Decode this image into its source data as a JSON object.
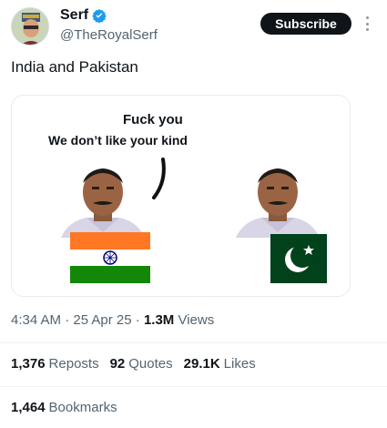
{
  "author": {
    "display_name": "Serf",
    "handle": "@TheRoyalSerf",
    "verified": true
  },
  "header": {
    "subscribe_label": "Subscribe"
  },
  "tweet": {
    "text": "India and Pakistan"
  },
  "media": {
    "caption_line1": "Fuck you",
    "caption_line2": "We don’t like your kind",
    "flags": [
      "india-flag",
      "pakistan-flag"
    ]
  },
  "meta": {
    "time": "4:34 AM",
    "date": "25 Apr 25",
    "views_count": "1.3M",
    "views_label": "Views",
    "sep": "·"
  },
  "stats": {
    "reposts_count": "1,376",
    "reposts_label": "Reposts",
    "quotes_count": "92",
    "quotes_label": "Quotes",
    "likes_count": "29.1K",
    "likes_label": "Likes",
    "bookmarks_count": "1,464",
    "bookmarks_label": "Bookmarks"
  },
  "colors": {
    "text_primary": "#0f1419",
    "text_secondary": "#536471",
    "verified_blue": "#1d9bf0",
    "india_saffron": "#ff7722",
    "india_green": "#138808",
    "pakistan_green": "#01411c"
  }
}
